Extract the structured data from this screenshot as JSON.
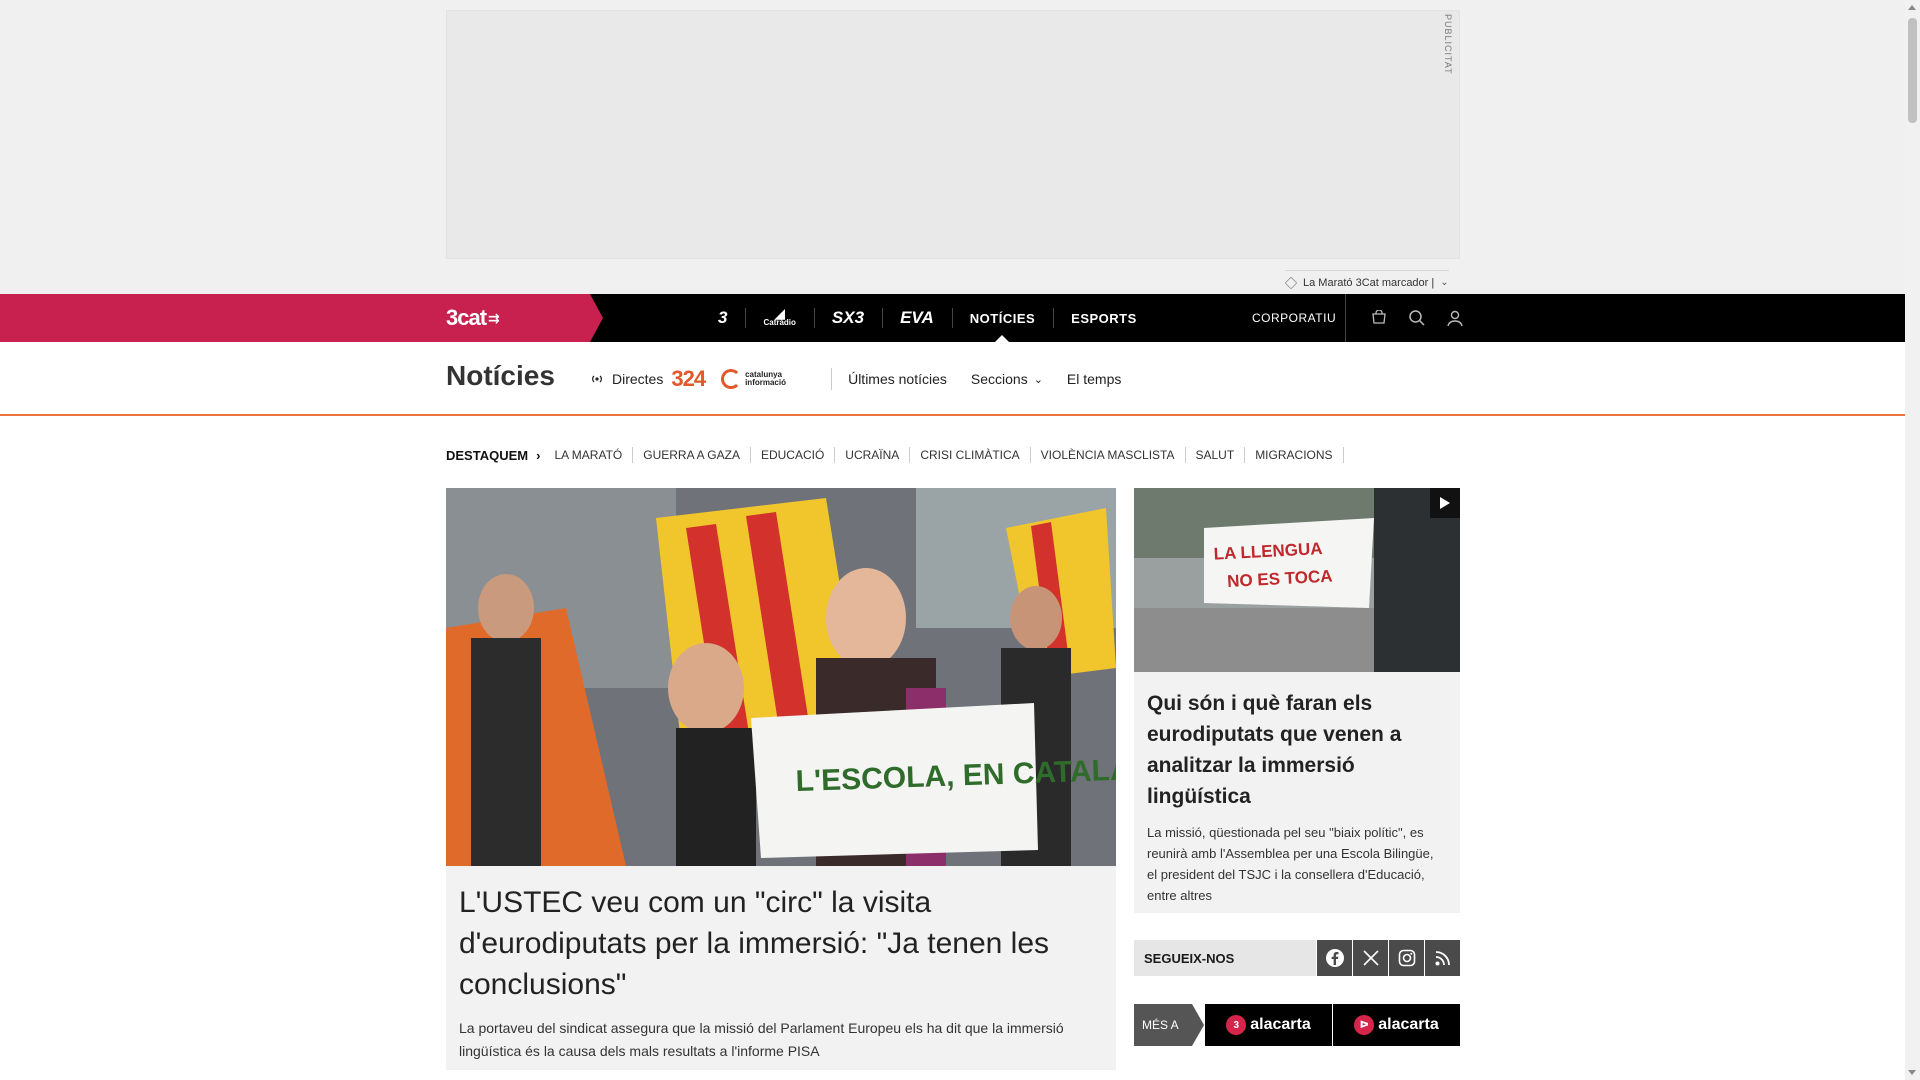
{
  "ad": {
    "label": "PUBLICITAT"
  },
  "promo": {
    "text": "La Marató 3Cat marcador |"
  },
  "topnav": {
    "logo": "3cat",
    "channels": [
      {
        "name": "3",
        "active": false
      },
      {
        "name": "Catràdio",
        "active": false
      },
      {
        "name": "SX3",
        "active": false
      },
      {
        "name": "EVA",
        "active": false
      },
      {
        "name": "NOTÍCIES",
        "active": true
      },
      {
        "name": "ESPORTS",
        "active": false
      }
    ],
    "corporate": "CORPORATIU",
    "icons": [
      "cart-icon",
      "search-icon",
      "user-icon"
    ]
  },
  "section": {
    "title": "Notícies",
    "directes": "Directes",
    "brand_324": "324",
    "brand_ci": "catalunya informació",
    "links": [
      "Últimes notícies",
      "Seccions",
      "El temps"
    ]
  },
  "highlights": {
    "title": "DESTAQUEM",
    "items": [
      "LA MARATÓ",
      "GUERRA A GAZA",
      "EDUCACIÓ",
      "UCRAÏNA",
      "CRISI CLIMÀTICA",
      "VIOLÈNCIA MASCLISTA",
      "SALUT",
      "MIGRACIONS"
    ]
  },
  "main_article": {
    "title": "L'USTEC veu com un \"circ\" la visita d'eurodiputats per la immersió: \"Ja tenen les conclusions\"",
    "summary": "La portaveu del sindicat assegura que la missió del Parlament Europeu els ha dit que la immersió lingüística és la causa dels mals resultats a l'informe PISA",
    "image_banner_text": "L'ESCOLA, EN CATALÀ"
  },
  "side_article": {
    "title": "Qui són i què faran els eurodiputats que venen a analitzar la immersió lingüística",
    "summary": "La missió, qüestionada pel seu \"biaix polític\", es reunirà amb l'Assemblea per una Escola Bilingüe, el president del TSJC i la consellera d'Educació, entre altres",
    "image_banner_text": "LA LLENGUA NO ES TOCA"
  },
  "follow": {
    "label": "SEGUEIX-NOS",
    "networks": [
      "facebook-icon",
      "x-icon",
      "instagram-icon",
      "rss-icon"
    ]
  },
  "alacarta": {
    "label": "MÉS A",
    "brands": [
      {
        "mark": "3",
        "name": "alacarta"
      },
      {
        "mark": "ᐅ",
        "name": "alacarta"
      }
    ]
  }
}
